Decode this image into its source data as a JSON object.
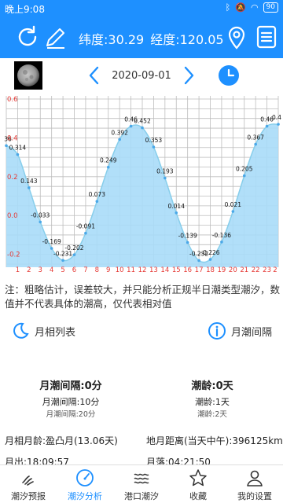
{
  "status": {
    "time": "晚上9:08",
    "battery": "90"
  },
  "header": {
    "latitude": "纬度:30.29",
    "longitude": "经度:120.05"
  },
  "date": "2020-09-01",
  "chart_data": {
    "type": "area",
    "x": [
      0,
      1,
      2,
      3,
      4,
      5,
      6,
      7,
      8,
      9,
      10,
      11,
      12,
      13,
      14,
      15,
      16,
      17,
      18,
      19,
      20,
      21,
      22,
      23,
      24
    ],
    "values": [
      0.36,
      0.314,
      0.143,
      -0.033,
      -0.169,
      -0.231,
      -0.202,
      -0.091,
      0.073,
      0.249,
      0.392,
      0.46,
      0.452,
      0.353,
      0.193,
      0.014,
      -0.139,
      -0.232,
      -0.226,
      -0.136,
      0.021,
      0.205,
      0.367,
      0.46,
      0.47
    ],
    "data_labels": [
      "36",
      "0.314",
      "0.143",
      "-0.033",
      "-0.169",
      "-0.231",
      "-0.202",
      "-0.091",
      "0.073",
      "0.249",
      "0.392",
      "0.46",
      "0.452",
      "0.353",
      "0.193",
      "0.014",
      "-0.139",
      "-0.232",
      "-0.226",
      "-0.136",
      "0.021",
      "0.205",
      "0.367",
      "0.46",
      "0.4"
    ],
    "y_ticks": [
      "0.6",
      "0.4",
      "0.2",
      "0.0",
      "-0.2"
    ],
    "x_ticks": [
      "1",
      "2",
      "3",
      "4",
      "5",
      "6",
      "7",
      "8",
      "9",
      "10",
      "11",
      "12",
      "13",
      "14",
      "15",
      "16",
      "17",
      "18",
      "19",
      "20",
      "21",
      "22",
      "23",
      "2"
    ],
    "ylim": [
      -0.25,
      0.6
    ],
    "xlim": [
      0,
      24
    ],
    "grid": true,
    "fill_color": "#a8dcf8",
    "line_color": "#87ceeb"
  },
  "note": "注：粗略估计，误差较大，并只能分析正规半日潮类型潮汐，数值并不代表具体的潮高，仅代表相对值",
  "tabs": {
    "moon_phase_list": "月相列表",
    "lunar_tide_interval": "月潮间隔"
  },
  "interval": {
    "left": {
      "main": "月潮间隔:0分",
      "second": "月潮间隔:10分",
      "third": "月潮间隔:20分"
    },
    "right": {
      "main": "潮龄:0天",
      "second": "潮龄:1天",
      "third": "潮龄:2天"
    }
  },
  "moon_info": {
    "phase": "月相月龄:盈凸月(13.06天)",
    "distance": "地月距离(当天中午):396125km",
    "moonrise": "月出:18:09:57",
    "moonset": "月落:04:21:50"
  },
  "nav": [
    {
      "label": "潮汐预报",
      "icon": "waves-icon"
    },
    {
      "label": "潮汐分析",
      "icon": "gauge-icon"
    },
    {
      "label": "港口潮汐",
      "icon": "harbor-waves-icon"
    },
    {
      "label": "收藏",
      "icon": "star-icon"
    },
    {
      "label": "我的设置",
      "icon": "user-icon"
    }
  ],
  "colors": {
    "primary": "#1e90ff",
    "axis_red": "#e53935",
    "fill": "#a8dcf8"
  }
}
